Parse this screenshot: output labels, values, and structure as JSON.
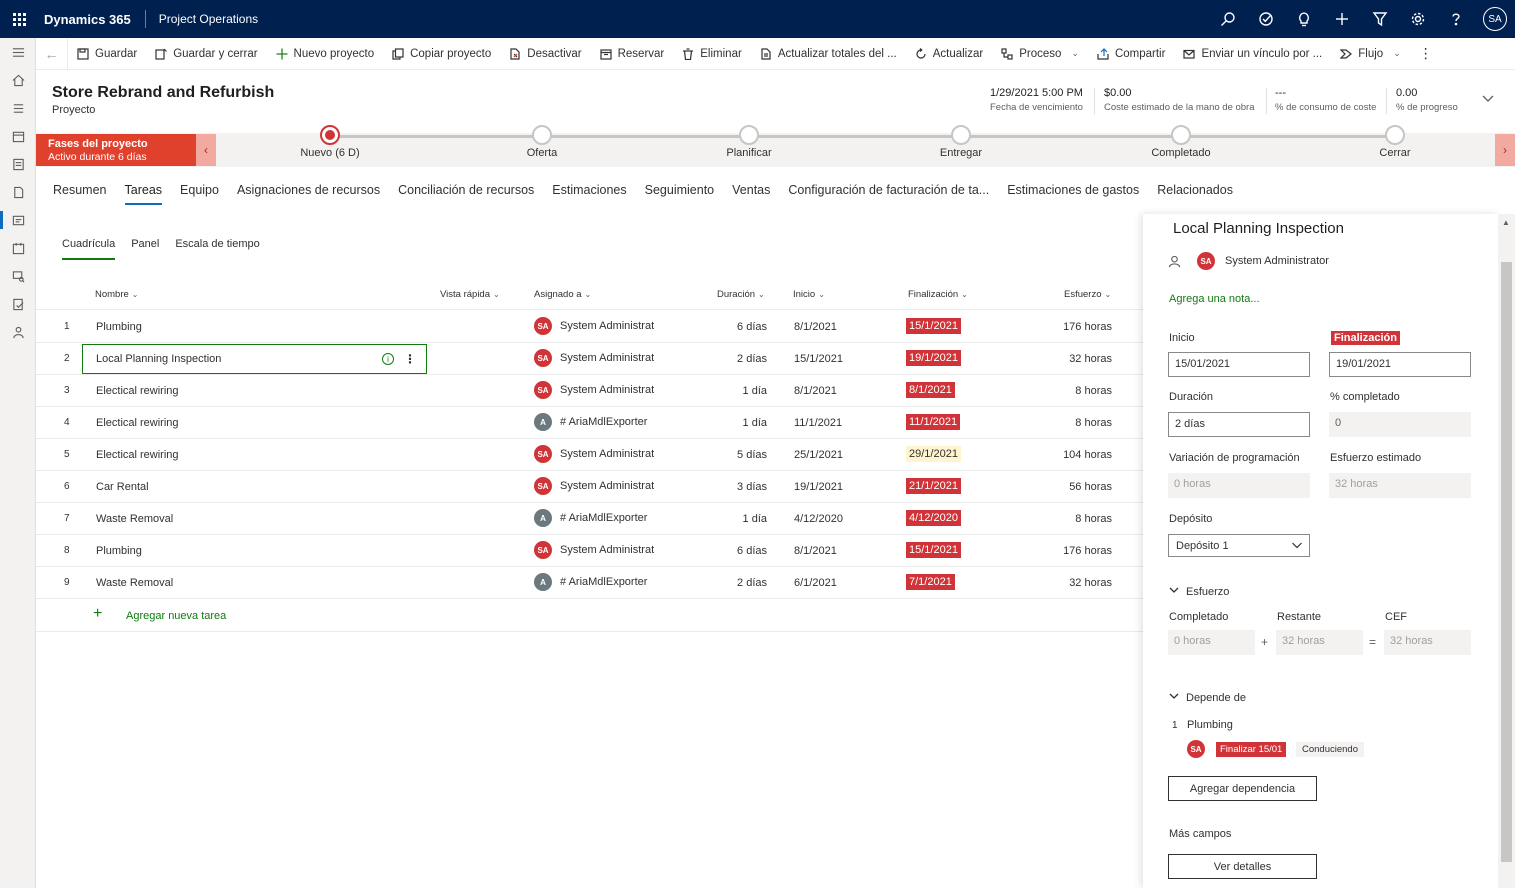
{
  "topbar": {
    "brand": "Dynamics 365",
    "app": "Project Operations",
    "user_initials": "SA"
  },
  "command_bar": {
    "items": [
      {
        "label": "Guardar",
        "icon": "save-icon"
      },
      {
        "label": "Guardar y cerrar",
        "icon": "save-close-icon"
      },
      {
        "label": "Nuevo proyecto",
        "icon": "plus-icon"
      },
      {
        "label": "Copiar proyecto",
        "icon": "copy-icon"
      },
      {
        "label": "Desactivar",
        "icon": "deactivate-icon"
      },
      {
        "label": "Reservar",
        "icon": "calendar-icon"
      },
      {
        "label": "Eliminar",
        "icon": "trash-icon"
      },
      {
        "label": "Actualizar totales del ...",
        "icon": "document-icon"
      },
      {
        "label": "Actualizar",
        "icon": "refresh-icon"
      },
      {
        "label": "Proceso",
        "icon": "process-icon"
      },
      {
        "label": "Compartir",
        "icon": "share-icon"
      },
      {
        "label": "Enviar un vínculo por ...",
        "icon": "mail-icon"
      },
      {
        "label": "Flujo",
        "icon": "flow-icon"
      }
    ]
  },
  "header": {
    "title": "Store Rebrand and Refurbish",
    "entity": "Proyecto",
    "fields": [
      {
        "value": "1/29/2021 5:00 PM",
        "label": "Fecha de vencimiento"
      },
      {
        "value": "$0.00",
        "label": "Coste estimado de la mano de obra"
      },
      {
        "value": "---",
        "label": "% de consumo de coste"
      },
      {
        "value": "0.00",
        "label": "% de progreso"
      }
    ]
  },
  "bpf": {
    "phase_title": "Fases del proyecto",
    "phase_sub": "Activo durante 6 días",
    "stages": [
      "Nuevo  (6 D)",
      "Oferta",
      "Planificar",
      "Entregar",
      "Completado",
      "Cerrar"
    ]
  },
  "tabs": [
    "Resumen",
    "Tareas",
    "Equipo",
    "Asignaciones de recursos",
    "Conciliación de recursos",
    "Estimaciones",
    "Seguimiento",
    "Ventas",
    "Configuración de facturación de ta...",
    "Estimaciones de gastos",
    "Relacionados"
  ],
  "subtabs": [
    "Cuadrícula",
    "Panel",
    "Escala de tiempo"
  ],
  "grid": {
    "columns": {
      "name": "Nombre",
      "quick": "Vista rápida",
      "assigned": "Asignado a",
      "duration": "Duración",
      "start": "Inicio",
      "end": "Finalización",
      "effort": "Esfuerzo"
    },
    "rows": [
      {
        "num": "1",
        "name": "Plumbing",
        "avatar": "SA",
        "assignee": "System Administrator",
        "duration": "6 días",
        "start": "8/1/2021",
        "end": "15/1/2021",
        "effort": "176 horas"
      },
      {
        "num": "2",
        "name": "Local Planning Inspection",
        "avatar": "SA",
        "assignee": "System Administrator",
        "duration": "2 días",
        "start": "15/1/2021",
        "end": "19/1/2021",
        "effort": "32 horas"
      },
      {
        "num": "3",
        "name": "Electical rewiring",
        "avatar": "SA",
        "assignee": "System Administrator",
        "duration": "1 día",
        "start": "8/1/2021",
        "end": "8/1/2021",
        "effort": "8 horas"
      },
      {
        "num": "4",
        "name": "Electical rewiring",
        "avatar": "A",
        "assignee": "# AriaMdlExporter",
        "duration": "1 día",
        "start": "11/1/2021",
        "end": "11/1/2021",
        "effort": "8 horas"
      },
      {
        "num": "5",
        "name": "Electical rewiring",
        "avatar": "SA",
        "assignee": "System Administrator",
        "duration": "5 días",
        "start": "25/1/2021",
        "end": "29/1/2021",
        "effort": "104 horas"
      },
      {
        "num": "6",
        "name": "Car Rental",
        "avatar": "SA",
        "assignee": "System Administrator",
        "duration": "3 días",
        "start": "19/1/2021",
        "end": "21/1/2021",
        "effort": "56 horas"
      },
      {
        "num": "7",
        "name": "Waste Removal",
        "avatar": "A",
        "assignee": "# AriaMdlExporter",
        "duration": "1 día",
        "start": "4/12/2020",
        "end": "4/12/2020",
        "effort": "8 horas"
      },
      {
        "num": "8",
        "name": "Plumbing",
        "avatar": "SA",
        "assignee": "System Administrator",
        "duration": "6 días",
        "start": "8/1/2021",
        "end": "15/1/2021",
        "effort": "176 horas"
      },
      {
        "num": "9",
        "name": "Waste Removal",
        "avatar": "A",
        "assignee": "# AriaMdlExporter",
        "duration": "2 días",
        "start": "6/1/2021",
        "end": "7/1/2021",
        "effort": "32 horas"
      }
    ],
    "add_label": "Agregar nueva tarea"
  },
  "panel": {
    "title": "Local Planning Inspection",
    "user_avatar": "SA",
    "user": "System Administrator",
    "note": "Agrega una nota...",
    "start_label": "Inicio",
    "start_value": "15/01/2021",
    "end_label": "Finalización",
    "end_value": "19/01/2021",
    "duration_label": "Duración",
    "duration_value": "2 días",
    "pct_label": "% completado",
    "pct_value": "0",
    "variance_label": "Variación de programación",
    "variance_value": "0 horas",
    "est_effort_label": "Esfuerzo estimado",
    "est_effort_value": "32 horas",
    "bucket_label": "Depósito",
    "bucket_value": "Depósito 1",
    "effort_section": "Esfuerzo",
    "completed_label": "Completado",
    "completed_value": "0 horas",
    "remaining_label": "Restante",
    "remaining_value": "32 horas",
    "cef_label": "CEF",
    "cef_value": "32 horas",
    "plus_op": "+",
    "eq_op": "=",
    "depends_section": "Depende de",
    "dep_num": "1",
    "dep_name": "Plumbing",
    "dep_avatar": "SA",
    "dep_badge": "Finalizar 15/01",
    "dep_status": "Conduciendo",
    "add_dep": "Agregar dependencia",
    "more_fields": "Más campos",
    "details": "Ver detalles"
  },
  "colors": {
    "topbar": "#002050",
    "accent_red": "#d13438",
    "accent_green": "#107c10"
  }
}
